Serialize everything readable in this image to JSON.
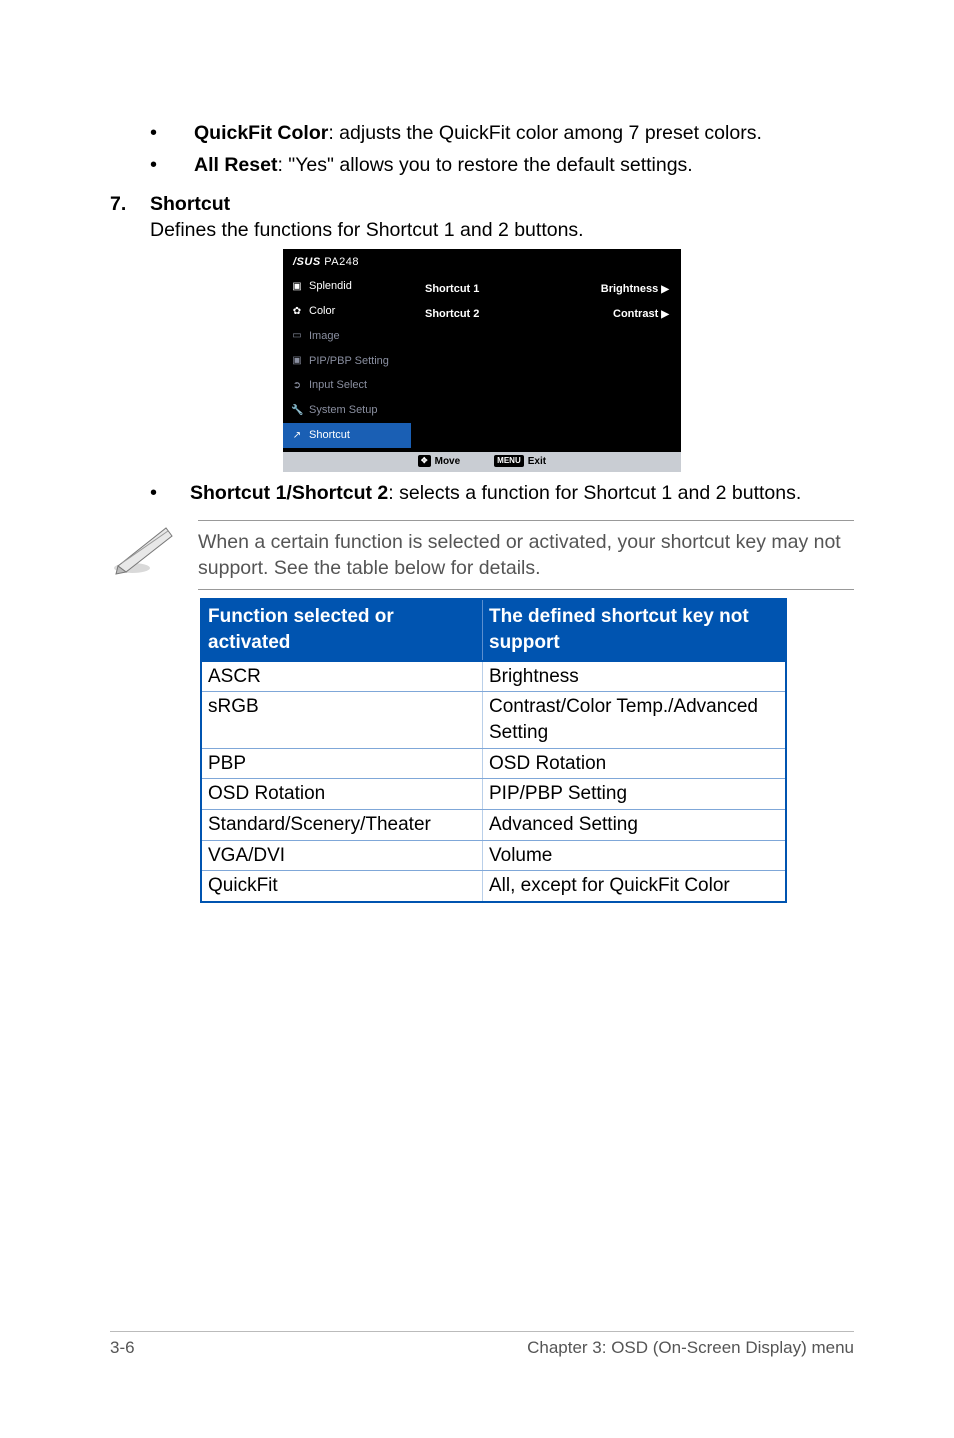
{
  "bullets_top": [
    {
      "strong": "QuickFit Color",
      "rest": ": adjusts the QuickFit color among 7 preset colors."
    },
    {
      "strong": "All Reset",
      "rest": ": \"Yes\" allows you to restore the default settings."
    }
  ],
  "section": {
    "num": "7.",
    "title": "Shortcut",
    "desc": "Defines the functions for Shortcut 1 and 2 buttons."
  },
  "osd": {
    "brand_model": "PA248",
    "left_items": [
      {
        "label": "Splendid",
        "cls": "white",
        "iconChar": "▣"
      },
      {
        "label": "Color",
        "cls": "white",
        "iconChar": "✿"
      },
      {
        "label": "Image",
        "cls": "",
        "iconChar": "▭"
      },
      {
        "label": "PIP/PBP Setting",
        "cls": "",
        "iconChar": "▣"
      },
      {
        "label": "Input Select",
        "cls": "",
        "iconChar": "➲"
      },
      {
        "label": "System Setup",
        "cls": "",
        "iconChar": "🔧"
      },
      {
        "label": "Shortcut",
        "cls": "sel",
        "iconChar": "↗"
      }
    ],
    "right_rows": [
      {
        "l": "Shortcut 1",
        "r": "Brightness"
      },
      {
        "l": "Shortcut 2",
        "r": "Contrast"
      }
    ],
    "foot": {
      "move_key": "✥",
      "move": "Move",
      "exit_key": "MENU",
      "exit": "Exit"
    }
  },
  "shortcut_bullet": {
    "strong": "Shortcut 1/Shortcut 2",
    "rest": ": selects a function for Shortcut 1 and 2 buttons."
  },
  "note": "When a certain function is selected or activated, your shortcut key may not support. See the table below for details.",
  "table": {
    "h1": "Function selected or activated",
    "h2": "The defined shortcut key not support",
    "rows": [
      [
        "ASCR",
        "Brightness"
      ],
      [
        "sRGB",
        "Contrast/Color Temp./Advanced Setting"
      ],
      [
        "PBP",
        "OSD Rotation"
      ],
      [
        "OSD Rotation",
        "PIP/PBP Setting"
      ],
      [
        "Standard/Scenery/Theater",
        "Advanced Setting"
      ],
      [
        "VGA/DVI",
        "Volume"
      ],
      [
        "QuickFit",
        "All, except for QuickFit Color"
      ]
    ]
  },
  "footer": {
    "left": "3-6",
    "right": "Chapter 3: OSD (On-Screen Display) menu"
  }
}
